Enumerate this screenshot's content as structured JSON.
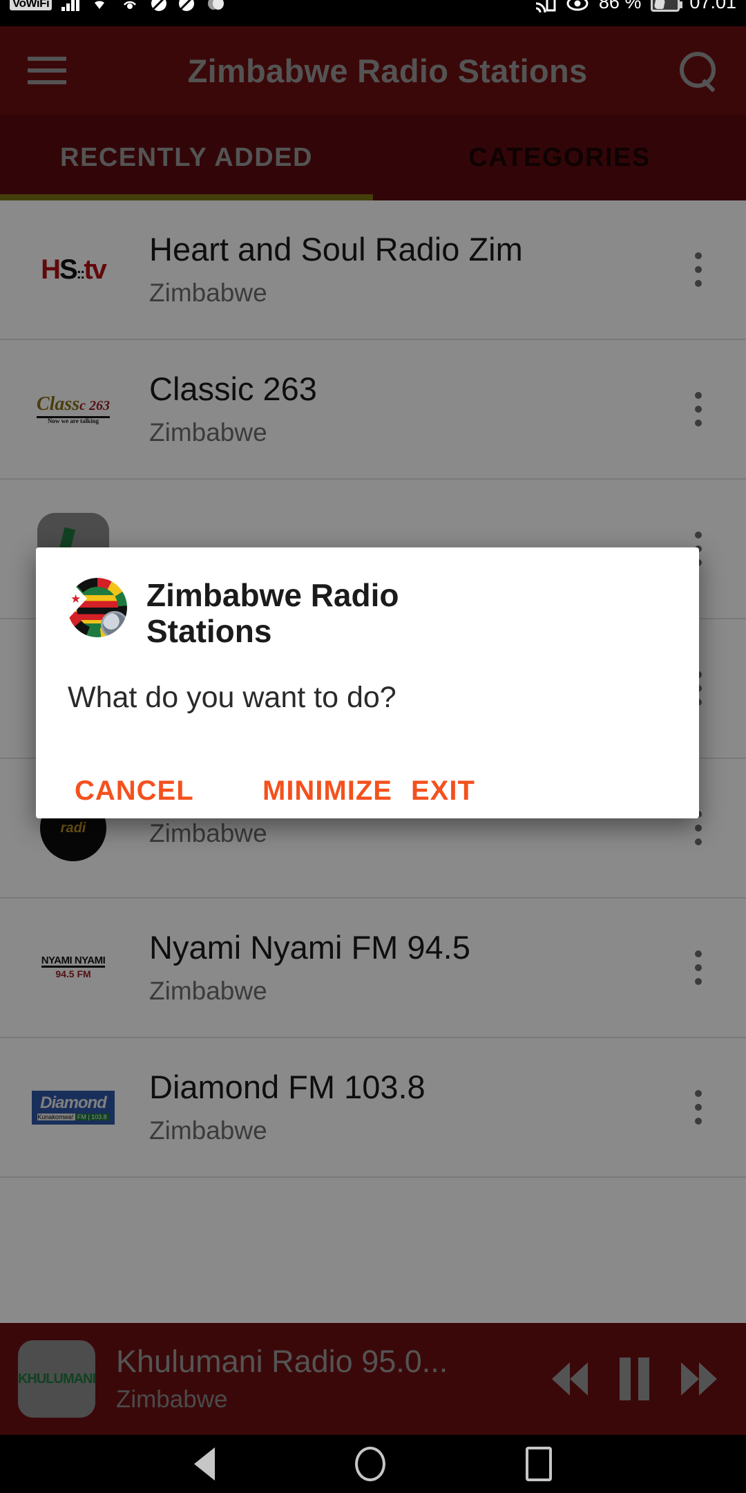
{
  "statusbar": {
    "vowifi_badge": "VoWiFi",
    "signal_icon": "signal-bars-icon",
    "wifi_icon": "wifi-icon",
    "hotspot_icon": "hotspot-icon",
    "dnd_icon_1": "do-not-disturb-icon",
    "dnd_icon_2": "do-not-disturb-icon",
    "sync_icon": "sync-icon",
    "cast_icon": "cast-icon",
    "eye_icon": "eye-care-icon",
    "battery_percent": "86 %",
    "battery_icon": "battery-charging-icon",
    "time": "07.01"
  },
  "appbar": {
    "menu_icon": "hamburger-menu-icon",
    "title": "Zimbabwe Radio Stations",
    "search_icon": "search-icon"
  },
  "tabs": [
    {
      "label": "RECENTLY ADDED",
      "active": true
    },
    {
      "label": "CATEGORIES",
      "active": false
    }
  ],
  "stations": [
    {
      "name": "Heart and Soul Radio Zim",
      "country": "Zimbabwe",
      "logo": "hstv-logo",
      "menu_icon": "overflow-menu-icon"
    },
    {
      "name": "Classic 263",
      "country": "Zimbabwe",
      "logo": "classic263-logo",
      "menu_icon": "overflow-menu-icon"
    },
    {
      "name": "",
      "country": "",
      "logo": "green-mic-logo",
      "menu_icon": "overflow-menu-icon"
    },
    {
      "name": "",
      "country": "",
      "logo": "p-logo",
      "menu_icon": "overflow-menu-icon"
    },
    {
      "name": "",
      "country": "Zimbabwe",
      "logo": "radi-logo",
      "menu_icon": "overflow-menu-icon"
    },
    {
      "name": "Nyami Nyami FM 94.5",
      "country": "Zimbabwe",
      "logo": "nyami-nyami-logo",
      "menu_icon": "overflow-menu-icon"
    },
    {
      "name": "Diamond FM 103.8",
      "country": "Zimbabwe",
      "logo": "diamond-fm-logo",
      "menu_icon": "overflow-menu-icon"
    }
  ],
  "player": {
    "logo": "khulumani-logo",
    "logo_text": "KHULUMANI",
    "title": "Khulumani Radio 95.0...",
    "country": "Zimbabwe",
    "rewind_icon": "rewind-icon",
    "pause_icon": "pause-icon",
    "forward_icon": "fast-forward-icon"
  },
  "dialog": {
    "app_icon": "zimbabwe-radio-app-icon",
    "title": "Zimbabwe Radio Stations",
    "message": "What do you want to do?",
    "buttons": [
      {
        "label": "CANCEL"
      },
      {
        "label": "MINIMIZE"
      },
      {
        "label": "EXIT"
      }
    ]
  },
  "navbar": {
    "back_icon": "back-triangle-icon",
    "home_icon": "home-circle-icon",
    "recents_icon": "recents-square-icon"
  },
  "colors": {
    "brand_maroon": "#6d0f12",
    "tab_bar": "#5d0c0f",
    "tab_indicator": "#7f7414",
    "accent_orange": "#f4511e"
  }
}
